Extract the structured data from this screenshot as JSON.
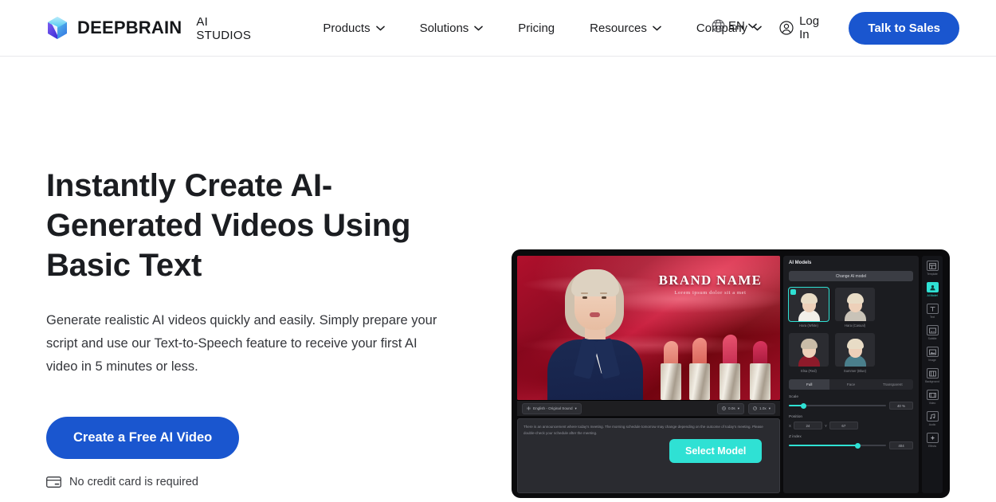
{
  "brand": {
    "name": "DEEPBRAIN",
    "subtitle": "AI STUDIOS",
    "logo_icon": "cube-logo-icon"
  },
  "header": {
    "nav": [
      {
        "label": "Products",
        "has_dropdown": true
      },
      {
        "label": "Solutions",
        "has_dropdown": true
      },
      {
        "label": "Pricing",
        "has_dropdown": false
      },
      {
        "label": "Resources",
        "has_dropdown": true
      },
      {
        "label": "Company",
        "has_dropdown": true
      }
    ],
    "language": {
      "label": "EN",
      "icon": "globe-icon"
    },
    "login": {
      "label": "Log In",
      "icon": "user-circle-icon"
    },
    "cta": {
      "label": "Talk to Sales"
    }
  },
  "hero": {
    "headline": "Instantly Create AI-Generated Videos Using Basic Text",
    "subtext": "Generate realistic AI videos quickly and easily. Simply prepare your script and use our Text-to-Speech feature to receive your first AI video in 5 minutes or less.",
    "cta_label": "Create a Free AI Video",
    "note": {
      "label": "No credit card is required",
      "icon": "credit-card-icon"
    }
  },
  "app_mock": {
    "stage": {
      "brand_title": "BRAND NAME",
      "brand_subtitle": "Lorem ipsum dolor sit a met",
      "language_chip": "English - Original Sound",
      "duration_chip": "0.0s",
      "speed_chip": "1.0x",
      "script_text": "There is an announcement where today's meeting. The morning schedule tomorrow may change depending on the outcome of today's meeting. Please double-check your schedule after the meeting.",
      "select_model_label": "Select Model"
    },
    "panel": {
      "title": "AI Models",
      "change_button": "Change AI model",
      "models": [
        {
          "name": "Hara (White)",
          "selected": true
        },
        {
          "name": "Hara (Casual)",
          "selected": false
        },
        {
          "name": "Elsa (Red)",
          "selected": false
        },
        {
          "name": "Summer (Blue)",
          "selected": false
        }
      ],
      "segments": [
        {
          "label": "Full",
          "active": true
        },
        {
          "label": "Face",
          "active": false
        },
        {
          "label": "Transparent",
          "active": false
        }
      ],
      "controls": [
        {
          "label": "Scale",
          "type": "slider",
          "value": "40 %",
          "fill_pct": 14
        },
        {
          "label": "Position",
          "type": "pair",
          "x": "24",
          "y": "67"
        },
        {
          "label": "Z index",
          "type": "slider",
          "value": "404",
          "fill_pct": 70
        }
      ]
    },
    "rail": [
      {
        "label": "Template",
        "icon": "template-icon",
        "active": false
      },
      {
        "label": "AI Model",
        "icon": "person-icon",
        "active": true
      },
      {
        "label": "Text",
        "icon": "text-icon",
        "active": false
      },
      {
        "label": "Subtitle",
        "icon": "subtitle-icon",
        "active": false
      },
      {
        "label": "Image",
        "icon": "image-icon",
        "active": false
      },
      {
        "label": "Background",
        "icon": "background-icon",
        "active": false
      },
      {
        "label": "Video",
        "icon": "video-icon",
        "active": false
      },
      {
        "label": "Audio",
        "icon": "audio-icon",
        "active": false
      },
      {
        "label": "Effects",
        "icon": "effects-icon",
        "active": false
      }
    ]
  },
  "colors": {
    "brand_blue": "#1a56cf",
    "accent_cyan": "#2fe1d4",
    "text_dark": "#1b1d21",
    "page_bg": "#ffffff"
  }
}
